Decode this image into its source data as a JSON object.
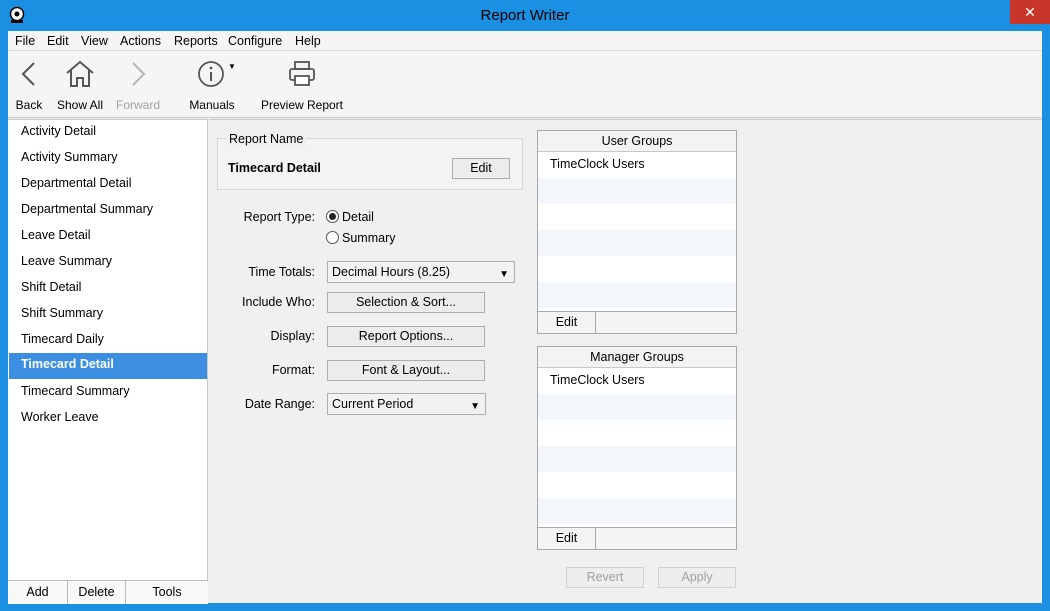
{
  "window": {
    "title": "Report Writer",
    "close_glyph": "✕"
  },
  "menu": [
    "File",
    "Edit",
    "View",
    "Actions",
    "Reports",
    "Configure",
    "Help"
  ],
  "toolbar": {
    "back": "Back",
    "show_all": "Show All",
    "forward": "Forward",
    "manuals": "Manuals",
    "preview": "Preview Report"
  },
  "sidebar": {
    "items": [
      "Activity Detail",
      "Activity Summary",
      "Departmental Detail",
      "Departmental Summary",
      "Leave Detail",
      "Leave Summary",
      "Shift Detail",
      "Shift Summary",
      "Timecard Daily",
      "Timecard Detail",
      "Timecard Summary",
      "Worker Leave"
    ],
    "selected": "Timecard Detail",
    "footer": {
      "add": "Add",
      "delete": "Delete",
      "tools": "Tools"
    }
  },
  "report": {
    "name_legend": "Report Name",
    "name": "Timecard Detail",
    "edit_label": "Edit",
    "type_label": "Report Type:",
    "type_detail": "Detail",
    "type_summary": "Summary",
    "totals_label": "Time Totals:",
    "totals_value": "Decimal Hours (8.25)",
    "include_label": "Include Who:",
    "include_btn": "Selection & Sort...",
    "display_label": "Display:",
    "display_btn": "Report Options...",
    "format_label": "Format:",
    "format_btn": "Font & Layout...",
    "range_label": "Date Range:",
    "range_value": "Current Period",
    "revert": "Revert",
    "apply": "Apply"
  },
  "user_groups": {
    "header": "User Groups",
    "items": [
      "TimeClock Users"
    ],
    "edit": "Edit"
  },
  "manager_groups": {
    "header": "Manager Groups",
    "items": [
      "TimeClock Users"
    ],
    "edit": "Edit"
  },
  "colors": {
    "titlebar": "#1b8fe2",
    "selection": "#3c8fe0",
    "close": "#c7352b"
  }
}
